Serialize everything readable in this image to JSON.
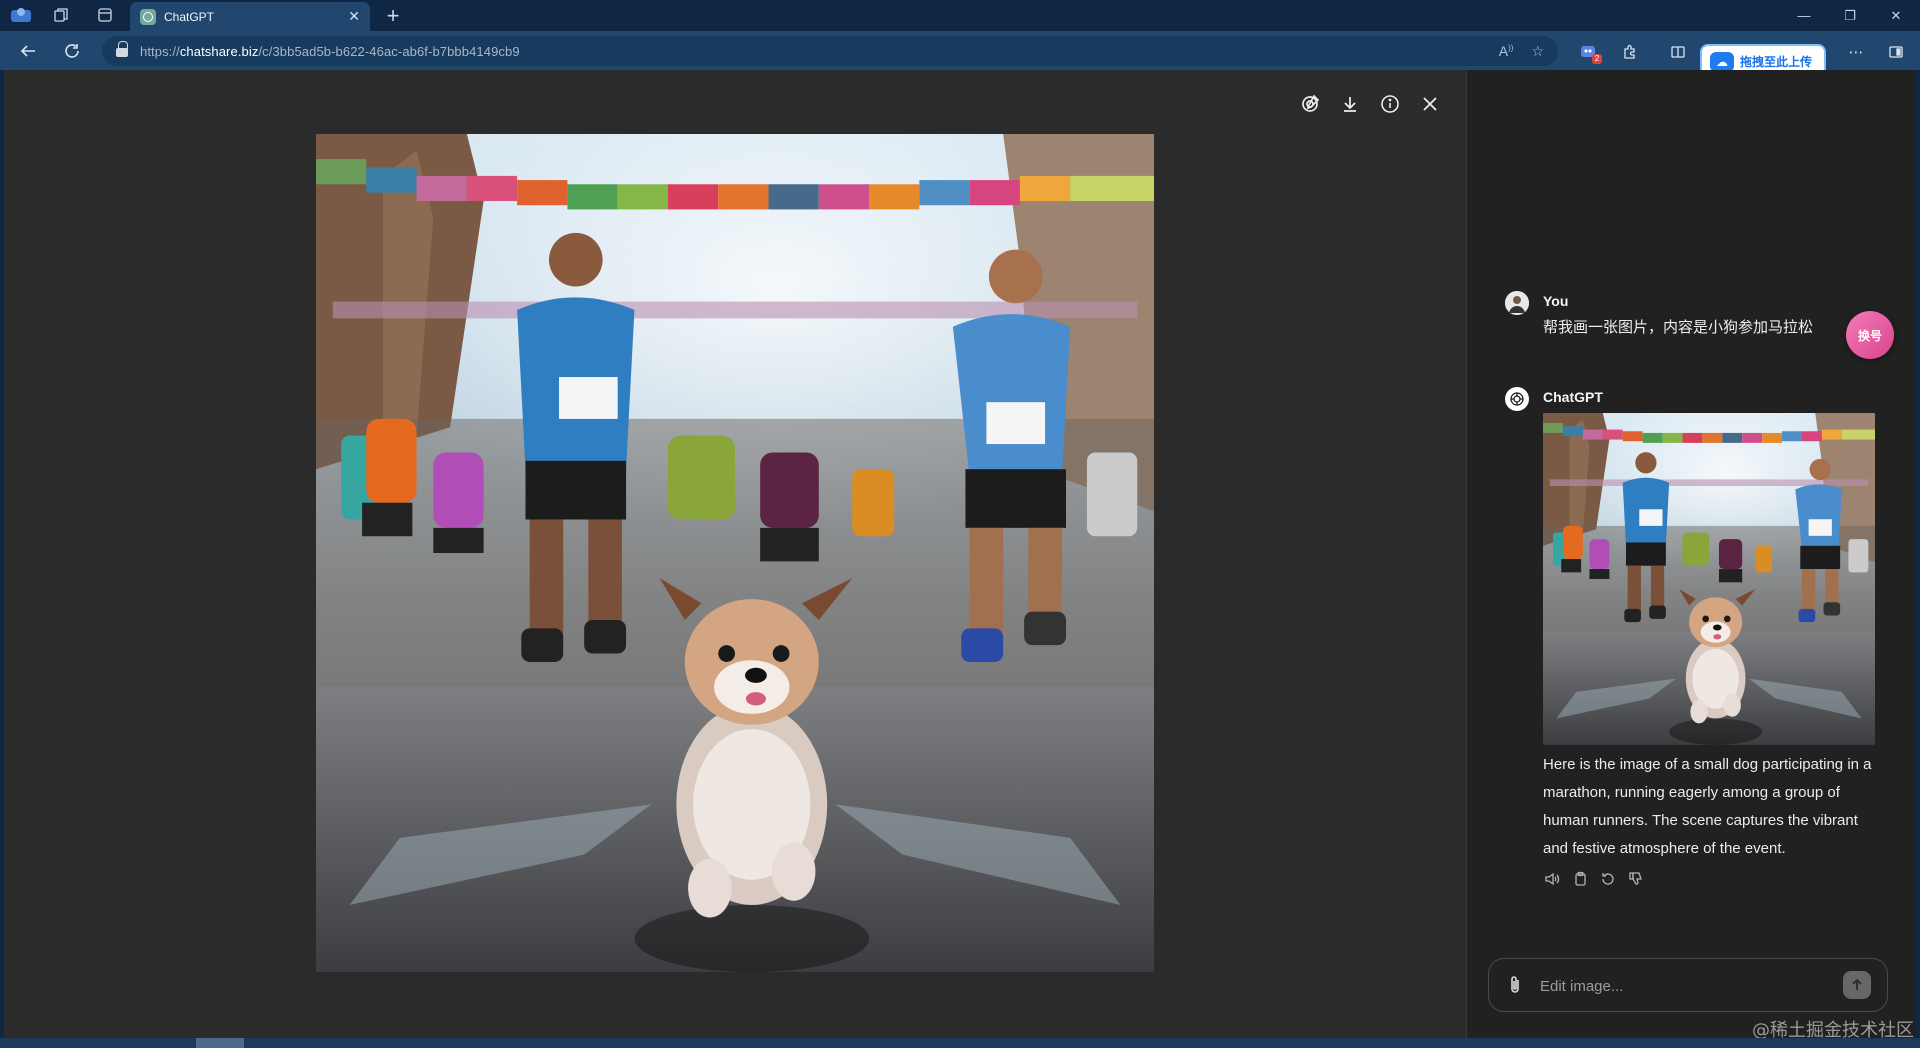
{
  "browser": {
    "tab": {
      "title": "ChatGPT"
    },
    "address": {
      "scheme": "https://",
      "host": "chatshare.biz",
      "path": "/c/3bb5ad5b-b622-46ac-ab6f-b7bbb4149cb9"
    },
    "extension_badge": "2",
    "upload_pill_label": "拖拽至此上传",
    "colors": {
      "titlebar": "#0f2744",
      "toolbar": "#21476f",
      "accent": "#1e7cf0"
    }
  },
  "viewer": {
    "tools": [
      "edit-icon",
      "download-icon",
      "info-icon",
      "close-icon"
    ],
    "image_alt": "Small dog running in a marathon among human runners"
  },
  "chat": {
    "user": {
      "name": "You",
      "message": "帮我画一张图片，内容是小狗参加马拉松"
    },
    "swap_button_label": "换号",
    "assistant": {
      "name": "ChatGPT",
      "message": "Here is the image of a small dog participating in a marathon, running eagerly among a group of human runners. The scene captures the vibrant and festive atmosphere of the event.",
      "actions": [
        "speaker-icon",
        "copy-icon",
        "regenerate-icon",
        "thumbs-down-icon"
      ]
    },
    "composer": {
      "placeholder": "Edit image..."
    }
  },
  "watermark": "@稀土掘金技术社区"
}
